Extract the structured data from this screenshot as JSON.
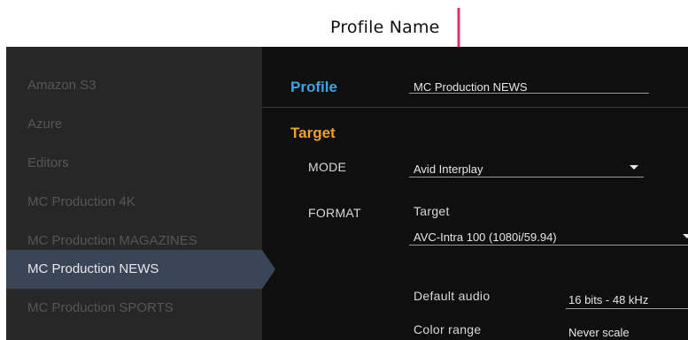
{
  "annotation": {
    "label": "Profile Name"
  },
  "sidebar": {
    "items": [
      {
        "label": "Amazon S3"
      },
      {
        "label": "Azure"
      },
      {
        "label": "Editors"
      },
      {
        "label": "MC Production 4K"
      },
      {
        "label": "MC Production MAGAZINES"
      },
      {
        "label": "MC Production NEWS"
      },
      {
        "label": "MC Production SPORTS"
      }
    ],
    "selected": "MC Production NEWS"
  },
  "profile": {
    "section_label": "Profile",
    "name_value": "MC Production NEWS"
  },
  "target": {
    "section_label": "Target",
    "mode_label": "MODE",
    "mode_value": "Avid Interplay",
    "format_label": "FORMAT",
    "format_sub_label": "Target",
    "format_value": "AVC-Intra 100 (1080i/59.94)",
    "default_audio_label": "Default audio",
    "default_audio_value": "16 bits - 48 kHz",
    "color_range_label": "Color range",
    "color_range_value": "Never scale"
  },
  "colors": {
    "profile_accent": "#3aa6e6",
    "target_accent": "#f1a12b",
    "annotation_arrow": "#e0306a",
    "selected_item": "#3b4558"
  }
}
